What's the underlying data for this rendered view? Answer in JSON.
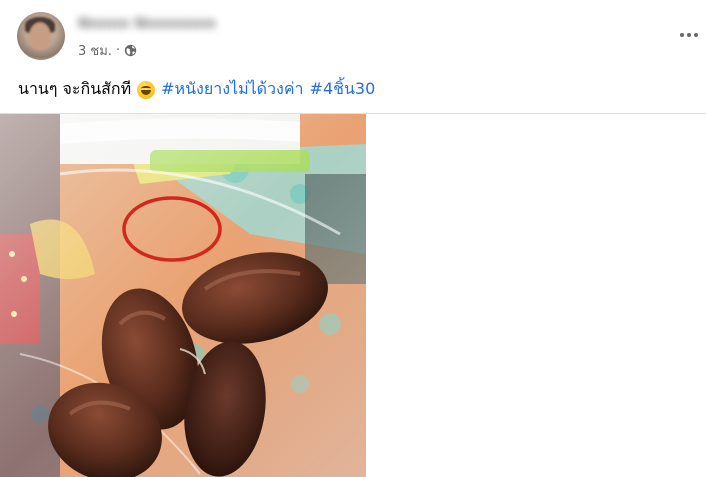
{
  "post": {
    "author": {
      "name": "Nnnnn Nnnnnnnn",
      "avatar_icon": "profile-avatar"
    },
    "timestamp": "3 ชม.",
    "separator": "·",
    "privacy_icon": "globe-icon",
    "more_icon": "more-options-icon",
    "text": "นานๆ จะกินสักที",
    "emoji": "grinning-face-emoji",
    "hashtags": [
      "#หนังยางไม่ได้วงค่า",
      "#4ชิ้น30"
    ],
    "link_color": "#216fdb",
    "photo": {
      "subject": "photo-of-grilled-sausages-in-plastic-bag"
    }
  }
}
